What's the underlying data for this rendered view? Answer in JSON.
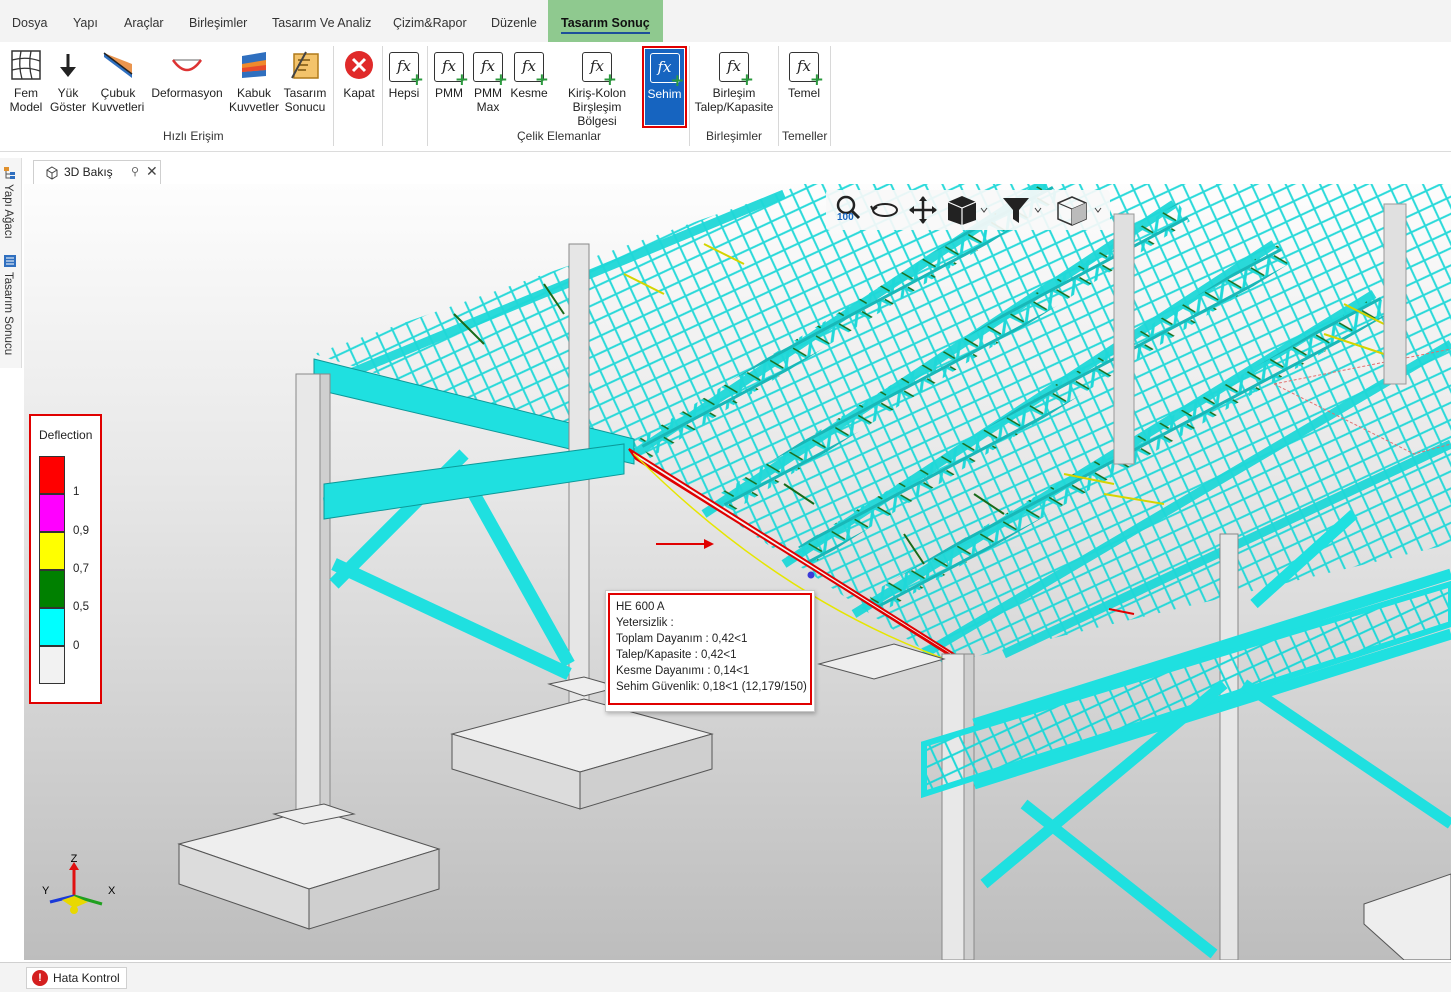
{
  "menu": {
    "tabs": [
      "Dosya",
      "Yapı",
      "Araçlar",
      "Birleşimler",
      "Tasarım Ve Analiz",
      "Çizim&Rapor",
      "Düzenle",
      "Tasarım Sonuç"
    ],
    "active_tab": "Tasarım Sonuç"
  },
  "ribbon": {
    "quick": {
      "fem_model": [
        "Fem",
        "Model"
      ],
      "yuk_goster": [
        "Yük",
        "Göster"
      ],
      "cubuk": [
        "Çubuk",
        "Kuvvetleri"
      ],
      "deformasyon": "Deformasyon",
      "kabuk": [
        "Kabuk",
        "Kuvvetler"
      ],
      "tasarim_sonucu": [
        "Tasarım",
        "Sonucu"
      ],
      "kapat": "Kapat",
      "group_label": "Hızlı Erişim"
    },
    "steel": {
      "hepsi": "Hepsi",
      "pmm": "PMM",
      "pmm_max": [
        "PMM",
        "Max"
      ],
      "kesme": "Kesme",
      "kiris_kolon": [
        "Kiriş-Kolon",
        "Birşleşim Bölgesi"
      ],
      "sehim": "Sehim",
      "group_label": "Çelik Elemanlar"
    },
    "connections": {
      "birlesim": [
        "Birleşim",
        "Talep/Kapasite"
      ],
      "group_label": "Birleşimler"
    },
    "foundations": {
      "temel": "Temel",
      "group_label": "Temeller"
    }
  },
  "sidebar": {
    "items": [
      "Yapı Ağacı",
      "Tasarım Sonucu"
    ]
  },
  "document_tab": {
    "title": "3D Bakış"
  },
  "view_toolbar": {
    "zoom_label": "100"
  },
  "legend": {
    "title": "Deflection",
    "colors": [
      "#ff0000",
      "#ff00ff",
      "#ffff00",
      "#008000",
      "#00ffff",
      "#f2f2f2"
    ],
    "values": [
      "1",
      "0,9",
      "0,7",
      "0,5",
      "0"
    ]
  },
  "tooltip": {
    "lines": [
      "HE 600 A",
      "Yetersizlik :",
      "Toplam Dayanım : 0,42<1",
      "Talep/Kapasite : 0,42<1",
      "Kesme Dayanımı : 0,14<1",
      "Sehim Güvenlik: 0,18<1 (12,179/150)"
    ]
  },
  "axes": {
    "z": "Z",
    "y": "Y",
    "x": "X"
  },
  "status": {
    "error_check": "Hata Kontrol"
  },
  "colors": {
    "steel_member": "#1fe0e0",
    "truss_diagonal_ok": "#1a6b1a",
    "highlight_red": "#e00000",
    "ribbon_selected": "#1664c0",
    "active_tab": "#8fc98f"
  }
}
